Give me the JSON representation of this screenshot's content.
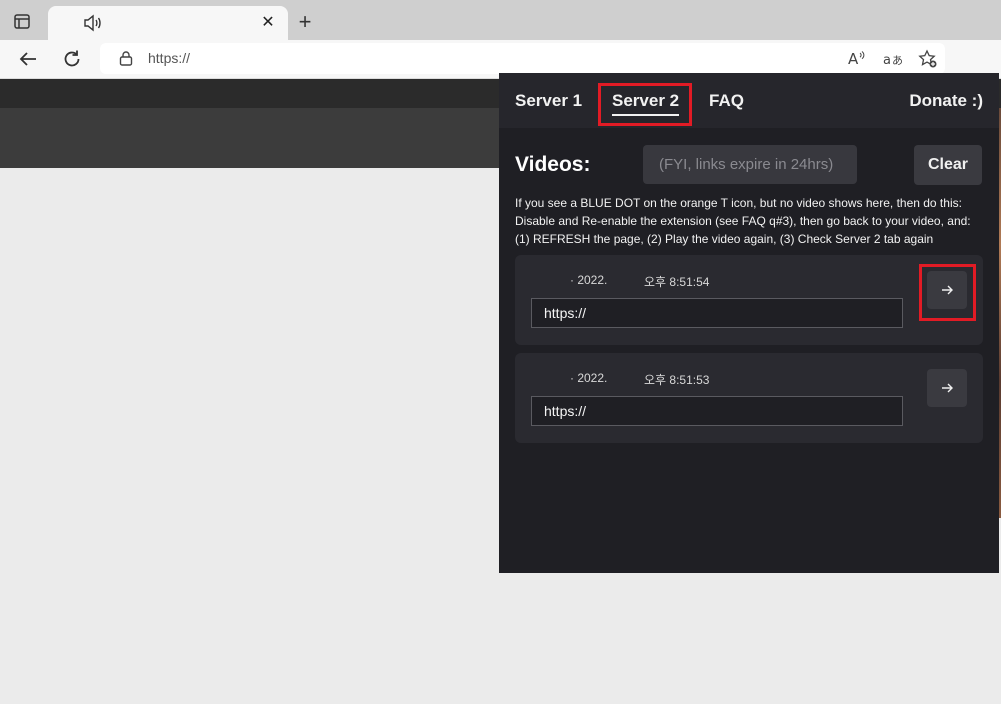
{
  "browser": {
    "tab": {
      "title": "",
      "close_glyph": "✕"
    },
    "new_tab_glyph": "+",
    "url": "https://",
    "toolbar_icons": [
      "read-aloud-icon",
      "translate-icon",
      "favorites-icon"
    ],
    "extension_icon": "T"
  },
  "popup": {
    "tabs": {
      "server1": "Server 1",
      "server2": "Server 2",
      "faq": "FAQ",
      "donate": "Donate :)"
    },
    "videos_title": "Videos:",
    "notice_placeholder": "(FYI, links expire in 24hrs)",
    "clear_label": "Clear",
    "instructions": [
      "If you see a BLUE DOT on the orange T icon, but no video shows here, then do this:",
      "Disable and Re-enable the extension (see FAQ q#3), then go back to your video, and:",
      "(1) REFRESH the page, (2) Play the video again, (3) Check Server 2 tab again"
    ],
    "videos": [
      {
        "date": "· 2022.",
        "time": "오후 8:51:54",
        "link": "https://"
      },
      {
        "date": "· 2022.",
        "time": "오후 8:51:53",
        "link": "https://"
      }
    ]
  },
  "colors": {
    "highlight": "#e21b25",
    "popup_bg": "#1f1f24",
    "accent_orange": "#f6a01a"
  }
}
